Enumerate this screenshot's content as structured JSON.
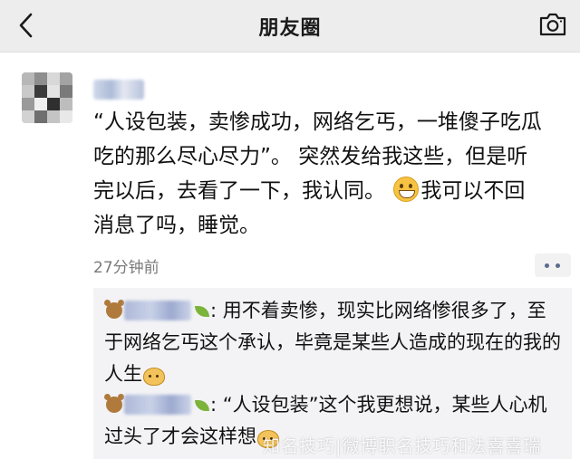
{
  "header": {
    "title": "朋友圈",
    "back_icon": "chevron-left-icon",
    "camera_icon": "camera-icon"
  },
  "post": {
    "text_line1": "“人设包装，卖惨成功，网络乞丐，一堆傻子吃瓜",
    "text_line2": "吃的那么尽心尽力”。 突然发给我这些，但是听",
    "text_line3_a": "完以后，去看了一下，我认同。 ",
    "text_line3_b": "我可以不回",
    "text_line4": "消息了吗，睡觉。",
    "time": "27分钟前"
  },
  "comments": [
    {
      "text": ": 用不着卖惨，现实比网络惨很多了，至于网络乞丐这个承认，毕竟是某些人造成的现在的我的人生"
    },
    {
      "text": ": “人设包装”这个我更想说，某些人心机过头了才会这样想"
    }
  ],
  "watermark": "知名技巧|微博职名技巧和法喜喜瑞"
}
